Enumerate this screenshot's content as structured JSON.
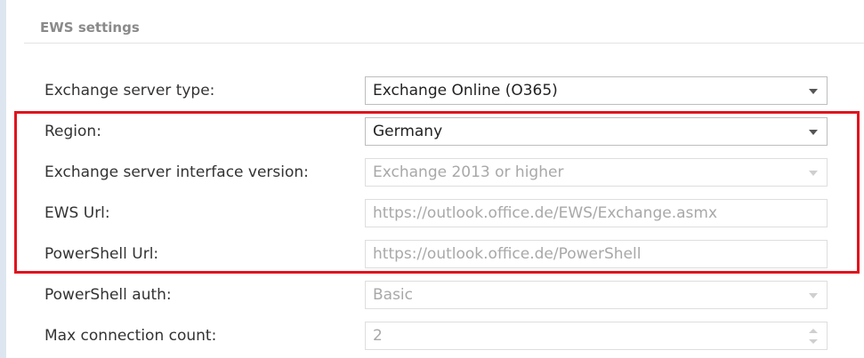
{
  "section": {
    "title": "EWS settings"
  },
  "rows": [
    {
      "label": "Exchange server type:",
      "value": "Exchange Online (O365)"
    },
    {
      "label": "Region:",
      "value": "Germany"
    },
    {
      "label": "Exchange server interface version:",
      "value": "Exchange 2013 or higher"
    },
    {
      "label": "EWS Url:",
      "value": "https://outlook.office.de/EWS/Exchange.asmx"
    },
    {
      "label": "PowerShell Url:",
      "value": "https://outlook.office.de/PowerShell"
    },
    {
      "label": "PowerShell auth:",
      "value": "Basic"
    },
    {
      "label": "Max connection count:",
      "value": "2"
    }
  ],
  "colors": {
    "highlight": "#e0141e",
    "background": "#dde6f0"
  },
  "icons": [
    "dropdown-arrow-icon",
    "spinner-up-icon",
    "spinner-down-icon"
  ]
}
